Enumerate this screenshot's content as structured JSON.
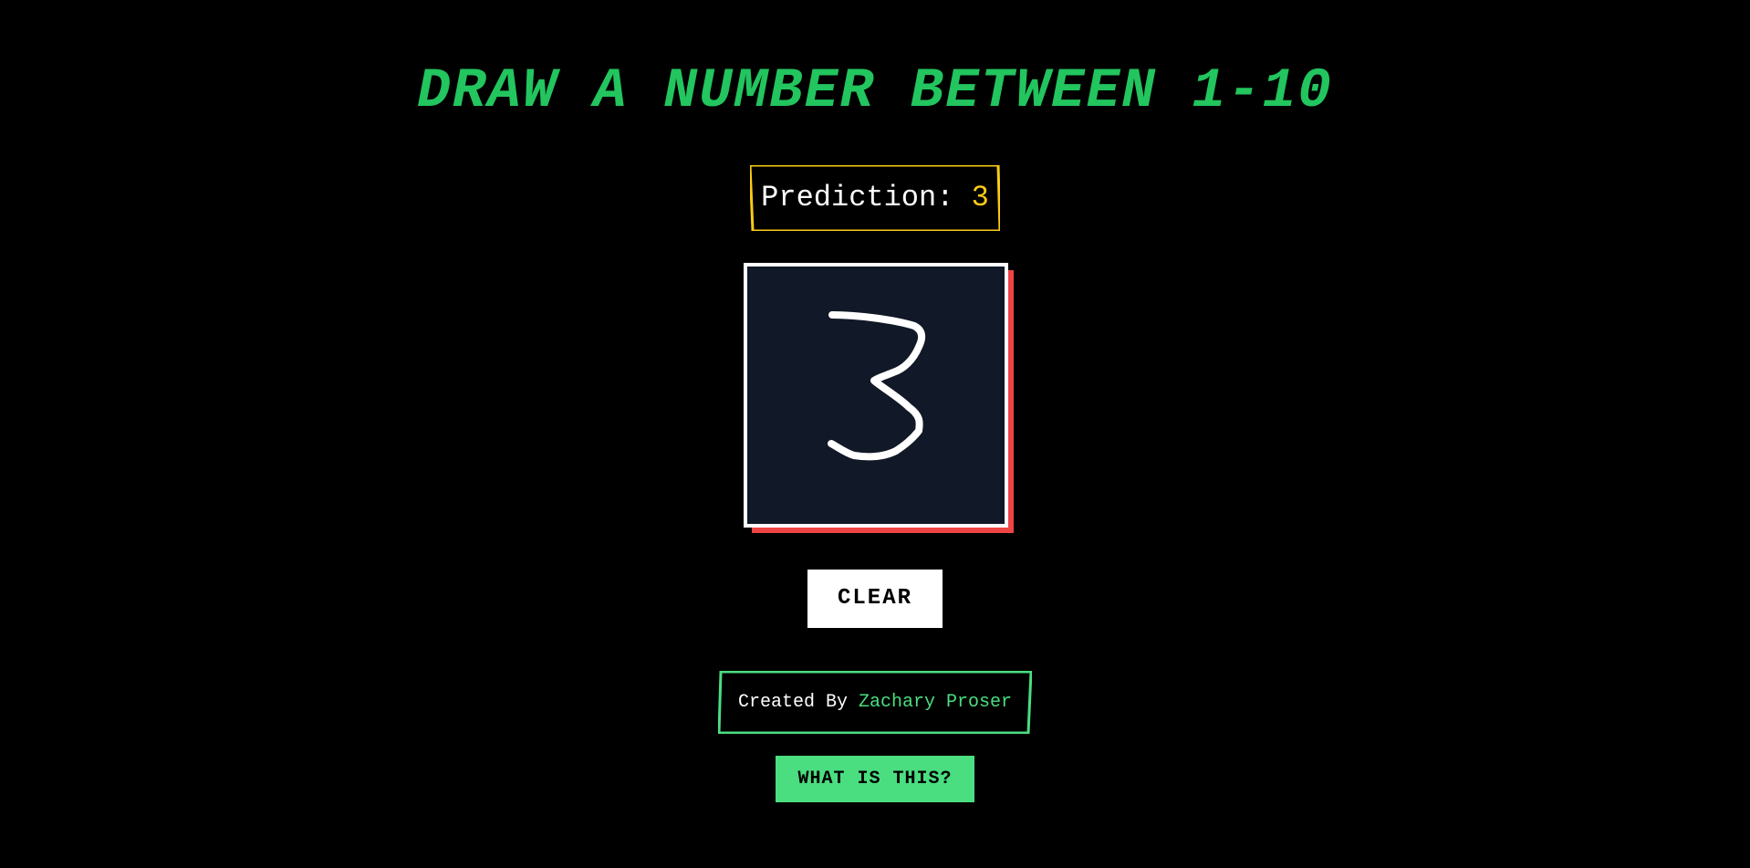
{
  "header": {
    "title": "DRAW A NUMBER BETWEEN 1-10"
  },
  "prediction": {
    "label": "Prediction:",
    "value": "3"
  },
  "canvas": {
    "drawn_digit": "3"
  },
  "controls": {
    "clear_label": "CLEAR"
  },
  "footer": {
    "credit_prefix": "Created By",
    "credit_name": "Zachary Proser",
    "about_label": "WHAT IS THIS?"
  },
  "colors": {
    "background": "#000000",
    "title_green": "#22c55e",
    "prediction_yellow": "#facc15",
    "canvas_shadow_red": "#ef4444",
    "canvas_bg": "#111827",
    "accent_green": "#4ade80"
  }
}
